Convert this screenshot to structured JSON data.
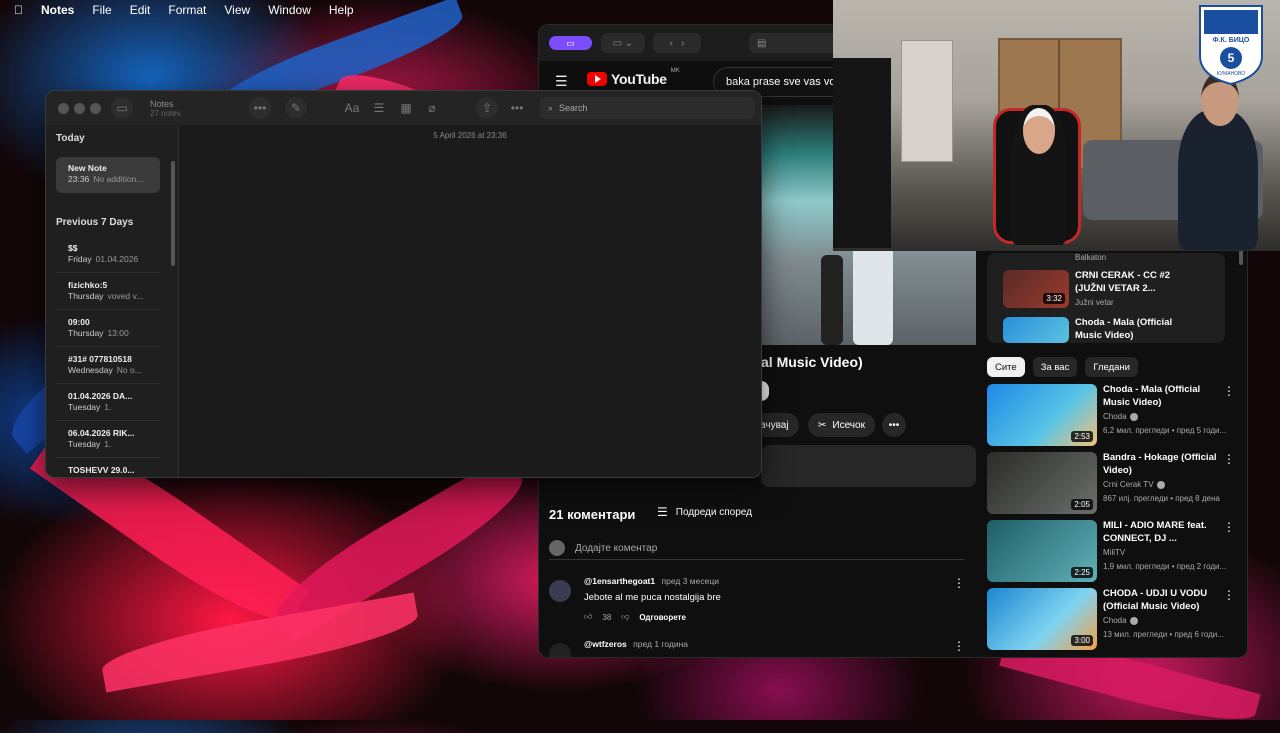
{
  "menubar": {
    "apple_icon": "apple-icon",
    "app": "Notes",
    "items": [
      "File",
      "Edit",
      "Format",
      "View",
      "Window",
      "Help"
    ]
  },
  "notes": {
    "title": "Notes",
    "subtitle": "27 notes",
    "editor_date": "5 April 2026 at 23:36",
    "search_placeholder": "Search",
    "group_today": "Today",
    "group_prev": "Previous 7 Days",
    "selected": {
      "title": "New Note",
      "time": "23:36",
      "preview": "No addition..."
    },
    "items": [
      {
        "title": "$$",
        "day": "Friday",
        "preview": "01.04.2026"
      },
      {
        "title": "fizichko:5",
        "day": "Thursday",
        "preview": "voved v..."
      },
      {
        "title": "09:00",
        "day": "Thursday",
        "preview": "13:00"
      },
      {
        "title": "#31# 077810518",
        "day": "Wednesday",
        "preview": "No o..."
      },
      {
        "title": "01.04.2026 DA...",
        "day": "Tuesday",
        "preview": "1."
      },
      {
        "title": "06.04.2026 RIK...",
        "day": "Tuesday",
        "preview": "1."
      },
      {
        "title": "TOSHEVV 29.0...",
        "day": "",
        "preview": ""
      }
    ]
  },
  "browser": {
    "yt_logo": "YouTube",
    "country": "MK",
    "search_value": "baka prase sve vas voli",
    "video_title": "al Music Video)",
    "save_label": "Зачувај",
    "clip_label": "Исечок",
    "comments_count": "21 коментари",
    "sort_label": "Подреди според",
    "add_comment": "Додајте коментар",
    "comments": [
      {
        "user": "@1ensarthegoat1",
        "when": "пред 3 месеци",
        "text": "Jebote al me puca nostalgija bre",
        "likes": "38",
        "reply": "Одговорете"
      },
      {
        "user": "@wtfzeros",
        "when": "пред 1 година",
        "text": "",
        "likes": "",
        "reply": ""
      }
    ],
    "chips": [
      "Сите",
      "За вас",
      "Гледани"
    ],
    "rec_top": [
      {
        "title": "",
        "channel": "Balkaton",
        "duration": ""
      },
      {
        "title": "CRNI CERAK - CC #2 (JUŽNI VETAR 2...",
        "channel": "Južni vetar",
        "duration": "3:32"
      },
      {
        "title": "Choda - Mala (Official Music Video)",
        "channel": "",
        "duration": ""
      }
    ],
    "recs": [
      {
        "title": "Choda - Mala (Official Music Video)",
        "channel": "Choda",
        "meta": "6,2 мил. прегледи • пред 5 годи...",
        "duration": "2:53",
        "thumb_color": "#2a8fd8"
      },
      {
        "title": "Bandra - Hokage (Official Video)",
        "channel": "Crni Cerak TV",
        "meta": "867 илј. прегледи • пред 8 дена",
        "duration": "2:05",
        "thumb_color": "#3a3a38"
      },
      {
        "title": "MILI - ADIO MARE feat. CONNECT, DJ ...",
        "channel": "MiliTV",
        "meta": "1,9 мил. прегледи • пред 2 годи...",
        "duration": "2:25",
        "thumb_color": "#2f7d86"
      },
      {
        "title": "CHODA - UDJI U VODU (Official Music Video)",
        "channel": "Choda",
        "meta": "13 мил. прегледи • пред 6 годи...",
        "duration": "3:00",
        "thumb_color": "#1c86d1"
      }
    ]
  },
  "badge": {
    "top": "Ф.К. БИЦО",
    "number": "5",
    "bottom": "КУМАНОВО"
  },
  "colors": {
    "accent_purple": "#7c4dff",
    "yt_red": "#ff0000"
  }
}
